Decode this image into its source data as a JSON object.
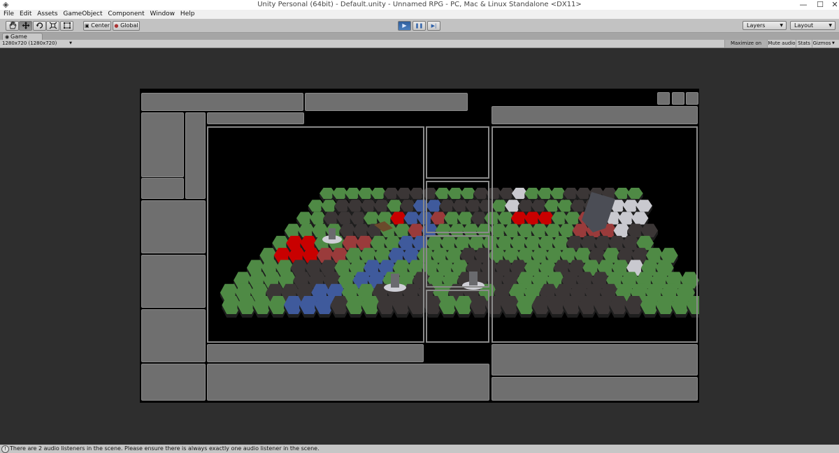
{
  "window": {
    "title": "Unity Personal (64bit) - Default.unity - Unnamed RPG - PC, Mac & Linux Standalone <DX11>",
    "minimize_glyph": "—",
    "maximize_glyph": "☐",
    "close_glyph": "✕"
  },
  "menu": [
    "File",
    "Edit",
    "Assets",
    "GameObject",
    "Component",
    "Window",
    "Help"
  ],
  "toolbar": {
    "tools": [
      "hand-icon",
      "move-icon",
      "rotate-icon",
      "scale-icon",
      "rect-icon"
    ],
    "active_tool": "move-icon",
    "pivot_label": "Center",
    "space_label": "Global",
    "play_glyph": "▶",
    "pause_glyph": "❚❚",
    "step_glyph": "▶|",
    "layers_label": "Layers",
    "layout_label": "Layout"
  },
  "game_tab": {
    "label": "Game",
    "resolution": "1280x720 (1280x720)",
    "buttons": [
      "Maximize on Play",
      "Mute audio",
      "Stats",
      "Gizmos"
    ]
  },
  "status": {
    "message": "There are 2 audio listeners in the scene. Please ensure there is always exactly one audio listener in the scene."
  },
  "colors": {
    "grass": "#4f8a45",
    "rock": "#3b3636",
    "water": "#3f5a9c",
    "road_red": "#c90000",
    "road_dim": "#9a3b3b",
    "snow": "#c9c9cf",
    "panel": "#6f6f6f",
    "frame": "#8a8a8a",
    "play_active": "#3e74b8"
  }
}
